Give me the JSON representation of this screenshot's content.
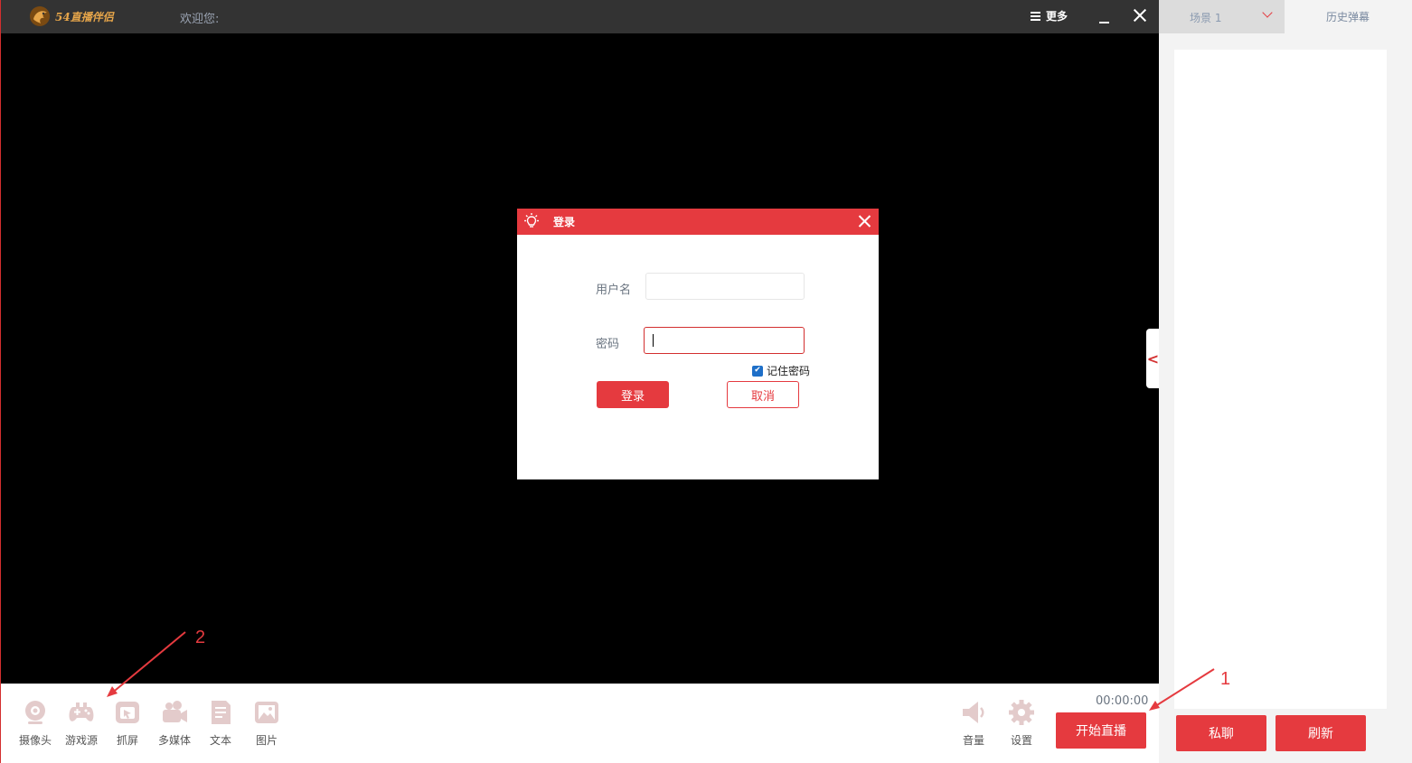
{
  "app": {
    "logo_text": "54直播伴侣",
    "welcome": "欢迎您:",
    "more_label": "更多"
  },
  "login": {
    "title": "登录",
    "username_label": "用户名",
    "username_value": "",
    "password_label": "密码",
    "password_value": "",
    "remember_label": "记住密码",
    "remember_checked": true,
    "login_button": "登录",
    "cancel_button": "取消"
  },
  "toolbar": {
    "sources": [
      {
        "label": "摄像头",
        "icon": "webcam-icon"
      },
      {
        "label": "游戏源",
        "icon": "gamepad-icon"
      },
      {
        "label": "抓屏",
        "icon": "screen-capture-icon"
      },
      {
        "label": "多媒体",
        "icon": "video-camera-icon"
      },
      {
        "label": "文本",
        "icon": "document-icon"
      },
      {
        "label": "图片",
        "icon": "image-icon"
      }
    ],
    "volume_label": "音量",
    "settings_label": "设置",
    "timer": "00:00:00",
    "start_button": "开始直播"
  },
  "annotations": {
    "one": "1",
    "two": "2"
  },
  "sidebar": {
    "scene_tab": "场景 1",
    "history_tab": "历史弹幕",
    "private_button": "私聊",
    "refresh_button": "刷新"
  },
  "colors": {
    "accent": "#e53a3f",
    "titlebar": "#333333",
    "stage": "#000000",
    "checkbox": "#1e6fc8"
  }
}
